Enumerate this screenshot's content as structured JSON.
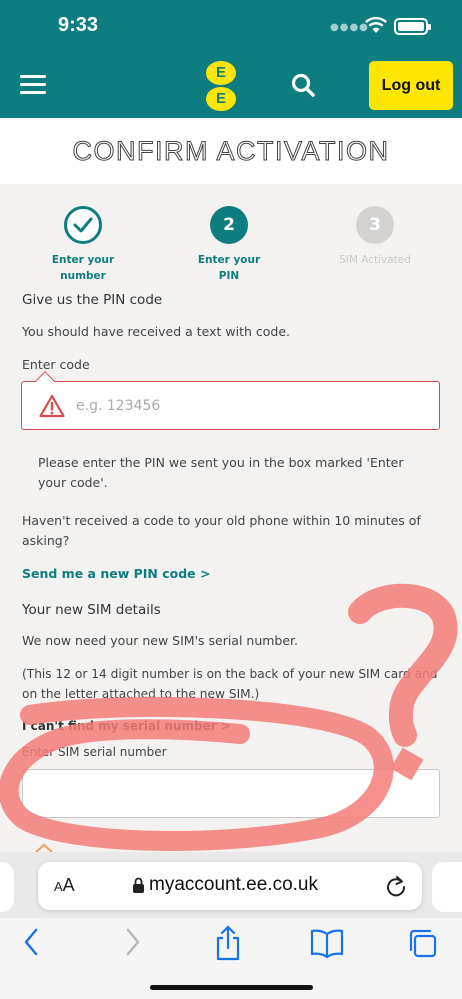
{
  "status_bar": {
    "time": "9:33",
    "battery_level": 1.0
  },
  "app_bar": {
    "menu_icon": "hamburger-icon",
    "logo_letters": [
      "E",
      "E"
    ],
    "search_icon": "search-icon",
    "logout_label": "Log out",
    "brand_color": "#0e7d7f",
    "accent_color": "#ffe600"
  },
  "page_title": "CONFIRM ACTIVATION",
  "steps": [
    {
      "number": "",
      "label_line1": "Enter your",
      "label_line2": "number",
      "state": "complete",
      "icon": "check-icon"
    },
    {
      "number": "2",
      "label_line1": "Enter your",
      "label_line2": "PIN",
      "state": "current"
    },
    {
      "number": "3",
      "label_line1": "SIM Activated",
      "label_line2": "",
      "state": "pending"
    }
  ],
  "pin": {
    "heading": "Give us the PIN code",
    "intro": "You should have received a text with code.",
    "field_label": "Enter code",
    "placeholder": "e.g. 123456",
    "error_icon": "warning-icon",
    "error_color": "#d54b52",
    "hint_line1": "Please enter the PIN we sent you in the box marked 'Enter",
    "hint_line2": "your code'.",
    "not_received_line1": "Haven't received a code to your old phone within 10 minutes of",
    "not_received_line2": "asking?",
    "resend_link": "Send me a new PIN code >"
  },
  "sim": {
    "heading": "Your new SIM details",
    "intro": "We now need your new SIM's serial number.",
    "note_line1": "(This 12 or 14 digit number is on the back of your new SIM card and",
    "note_line2": "on the letter attached to the new SIM.)",
    "help_link": "I can't find my serial number >",
    "field_label": "Enter SIM serial number",
    "value": ""
  },
  "browser": {
    "aa_label_small": "A",
    "aa_label_large": "A",
    "url": "myaccount.ee.co.uk",
    "toolbar_icons": [
      "back-icon",
      "forward-icon",
      "share-icon",
      "bookmarks-icon",
      "tabs-icon"
    ]
  },
  "annotation": {
    "color": "#f37c78"
  }
}
